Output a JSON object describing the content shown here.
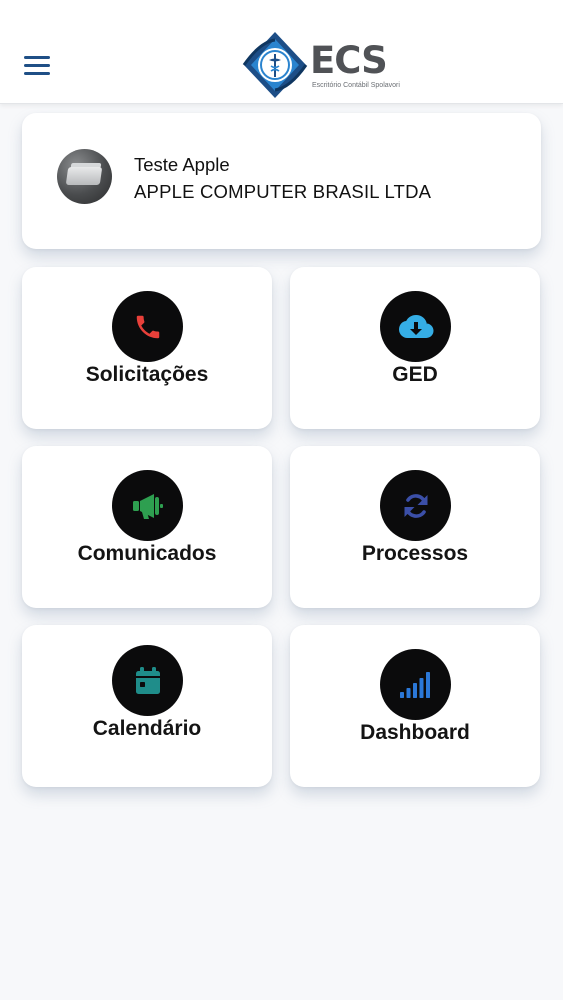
{
  "header": {
    "logo_text": "ECS",
    "logo_subtitle": "Escritório Contábil Spolavori"
  },
  "profile": {
    "name": "Teste Apple",
    "company": "APPLE COMPUTER BRASIL LTDA"
  },
  "tiles": [
    {
      "label": "Solicitações",
      "icon": "phone-icon",
      "icon_color": "#e8403a"
    },
    {
      "label": "GED",
      "icon": "cloud-download-icon",
      "icon_color": "#35aee6"
    },
    {
      "label": "Comunicados",
      "icon": "megaphone-icon",
      "icon_color": "#2e9f50"
    },
    {
      "label": "Processos",
      "icon": "sync-icon",
      "icon_color": "#3b4fa8"
    },
    {
      "label": "Calendário",
      "icon": "calendar-icon",
      "icon_color": "#1f8d8a"
    },
    {
      "label": "Dashboard",
      "icon": "signal-bars-icon",
      "icon_color": "#2b78d8"
    }
  ],
  "colors": {
    "brand_blue": "#1f4f86",
    "background": "#f7f8fa",
    "card": "#ffffff"
  }
}
